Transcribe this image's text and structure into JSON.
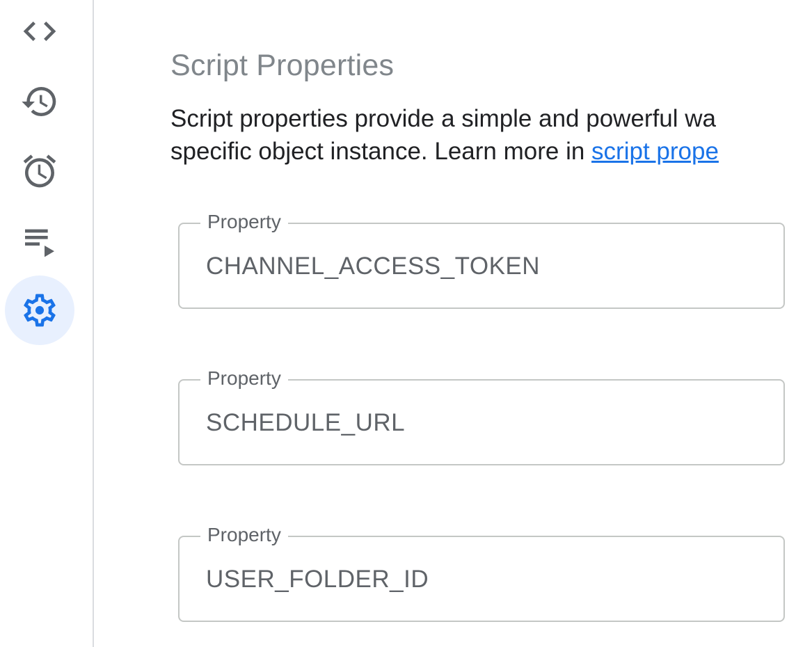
{
  "sidebar": {
    "items": [
      {
        "name": "editor",
        "icon": "code-icon",
        "active": false
      },
      {
        "name": "history",
        "icon": "history-icon",
        "active": false
      },
      {
        "name": "triggers",
        "icon": "alarm-clock-icon",
        "active": false
      },
      {
        "name": "executions",
        "icon": "playlist-play-icon",
        "active": false
      },
      {
        "name": "settings",
        "icon": "gear-icon",
        "active": true
      }
    ]
  },
  "colors": {
    "accent": "#1a73e8",
    "active_bg": "#e8f0fe",
    "icon_gray": "#5f6368",
    "title_gray": "#80868b",
    "border": "#c4c7c5"
  },
  "main": {
    "title": "Script Properties",
    "description": {
      "line1": "Script properties provide a simple and powerful wa",
      "line2_prefix": "specific object instance. Learn more in ",
      "link_text": "script prope"
    },
    "properties": [
      {
        "label": "Property",
        "value": "CHANNEL_ACCESS_TOKEN"
      },
      {
        "label": "Property",
        "value": "SCHEDULE_URL"
      },
      {
        "label": "Property",
        "value": "USER_FOLDER_ID"
      }
    ]
  }
}
